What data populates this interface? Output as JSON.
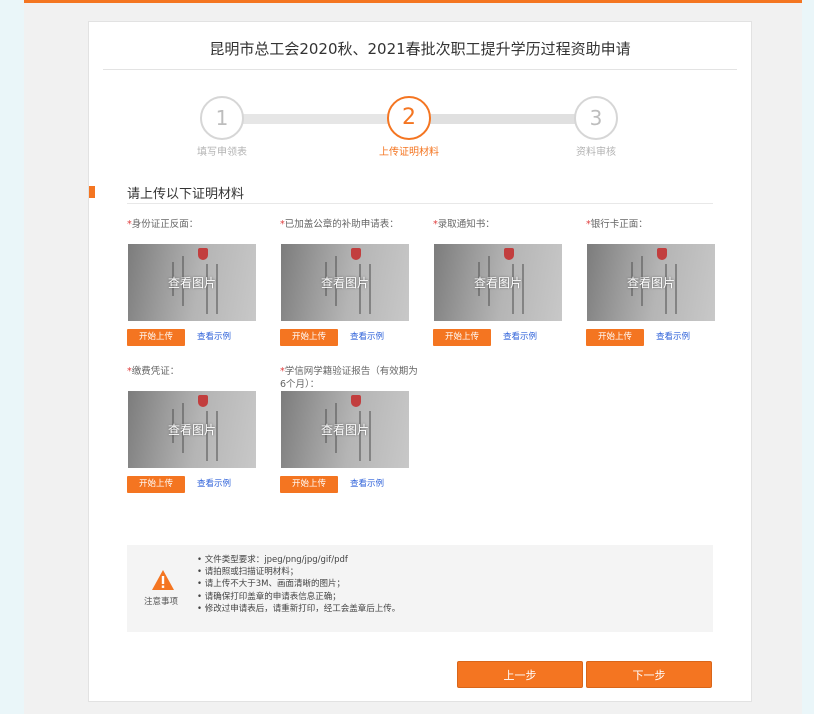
{
  "page": {
    "title": "昆明市总工会2020秋、2021春批次职工提升学历过程资助申请"
  },
  "steps": [
    {
      "number": "1",
      "label": "填写申领表"
    },
    {
      "number": "2",
      "label": "上传证明材料"
    },
    {
      "number": "3",
      "label": "资料审核"
    }
  ],
  "current_step": 2,
  "section": {
    "title": "请上传以下证明材料"
  },
  "documents": [
    {
      "required_mark": "*",
      "label": "身份证正反面：",
      "view_text": "查看图片",
      "upload_label": "开始上传",
      "example_label": "查看示例"
    },
    {
      "required_mark": "*",
      "label": "已加盖公章的补助申请表：",
      "view_text": "查看图片",
      "upload_label": "开始上传",
      "example_label": "查看示例"
    },
    {
      "required_mark": "*",
      "label": "录取通知书：",
      "view_text": "查看图片",
      "upload_label": "开始上传",
      "example_label": "查看示例"
    },
    {
      "required_mark": "*",
      "label": "银行卡正面：",
      "view_text": "查看图片",
      "upload_label": "开始上传",
      "example_label": "查看示例"
    },
    {
      "required_mark": "*",
      "label": "缴费凭证：",
      "view_text": "查看图片",
      "upload_label": "开始上传",
      "example_label": "查看示例"
    },
    {
      "required_mark": "*",
      "label": "学信网学籍验证报告（有效期为6个月）：",
      "view_text": "查看图片",
      "upload_label": "开始上传",
      "example_label": "查看示例"
    }
  ],
  "notice": {
    "icon": "warning-triangle-icon",
    "label": "注意事项",
    "items": [
      "• 文件类型要求：jpeg/png/jpg/gif/pdf",
      "• 请拍照或扫描证明材料；",
      "• 请上传不大于3M、画面清晰的图片；",
      "• 请确保打印盖章的申请表信息正确；",
      "• 修改过申请表后，请重新打印，经工会盖章后上传。"
    ]
  },
  "buttons": {
    "prev_label": "上一步",
    "next_label": "下一步"
  },
  "colors": {
    "accent": "#f47521",
    "link": "#2b5fd9",
    "required": "#e03c3c"
  }
}
